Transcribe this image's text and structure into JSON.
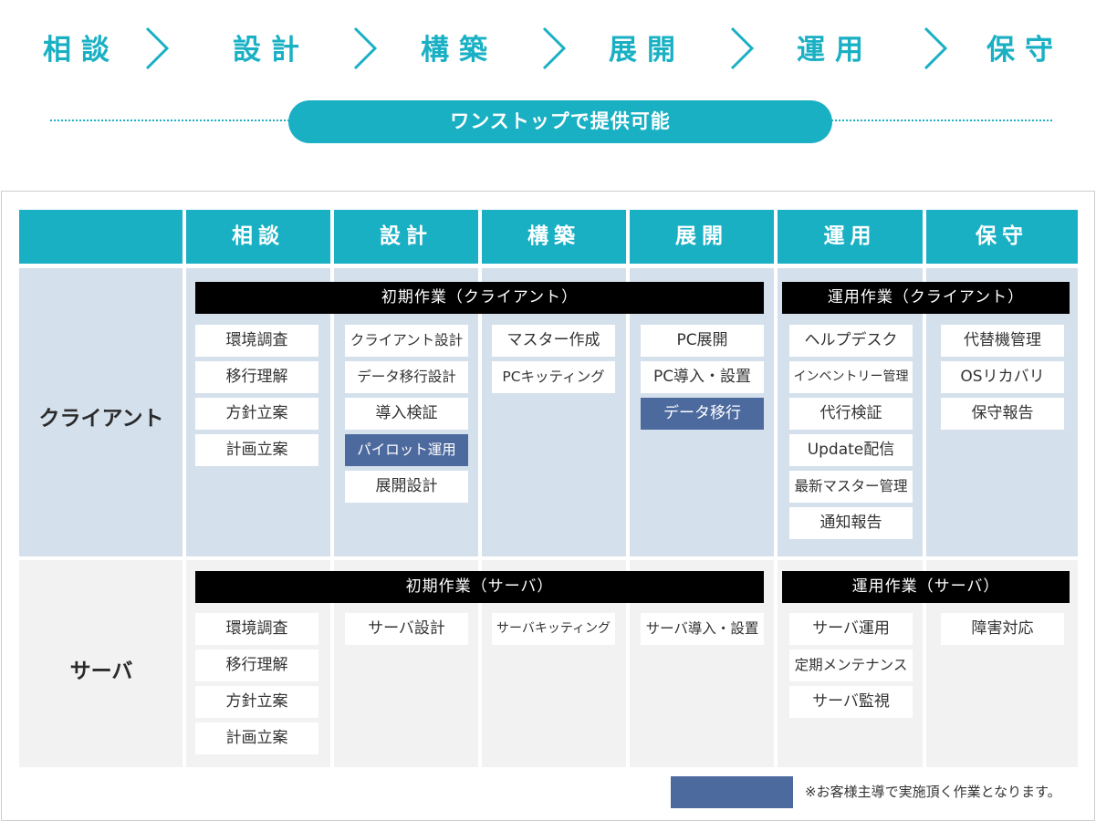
{
  "flow": {
    "steps": [
      "相談",
      "設計",
      "構築",
      "展開",
      "運用",
      "保守"
    ],
    "chevron_icon": "chevron-right-icon",
    "banner": "ワンストップで提供可能"
  },
  "table": {
    "headers": [
      "相談",
      "設計",
      "構築",
      "展開",
      "運用",
      "保守"
    ],
    "rows": {
      "client": {
        "label": "クライアント",
        "initial_bar": "初期作業（クライアント）",
        "ops_bar": "運用作業（クライアント）",
        "columns": [
          [
            "環境調査",
            "移行理解",
            "方針立案",
            "計画立案"
          ],
          [
            "クライアント設計",
            "データ移行設計",
            "導入検証",
            "パイロット運用",
            "展開設計"
          ],
          [
            "マスター作成",
            "PCキッティング"
          ],
          [
            "PC展開",
            "PC導入・設置",
            "データ移行"
          ],
          [
            "ヘルプデスク",
            "インベントリー管理",
            "代行検証",
            "Update配信",
            "最新マスター管理",
            "通知報告"
          ],
          [
            "代替機管理",
            "OSリカバリ",
            "保守報告"
          ]
        ],
        "customer_led": [
          "パイロット運用",
          "データ移行"
        ]
      },
      "server": {
        "label": "サーバ",
        "initial_bar": "初期作業（サーバ）",
        "ops_bar": "運用作業（サーバ）",
        "columns": [
          [
            "環境調査",
            "移行理解",
            "方針立案",
            "計画立案"
          ],
          [
            "サーバ設計"
          ],
          [
            "サーバキッティング"
          ],
          [
            "サーバ導入・設置"
          ],
          [
            "サーバ運用",
            "定期メンテナンス",
            "サーバ監視"
          ],
          [
            "障害対応"
          ]
        ]
      }
    }
  },
  "legend": {
    "note": "※お客様主導で実施頂く作業となります。"
  },
  "colors": {
    "accent": "#1ab0c4",
    "client_row": "#d4e0ec",
    "server_row": "#f2f2f2",
    "customer_led": "#4d6a9f",
    "phase_bar": "#000000"
  }
}
